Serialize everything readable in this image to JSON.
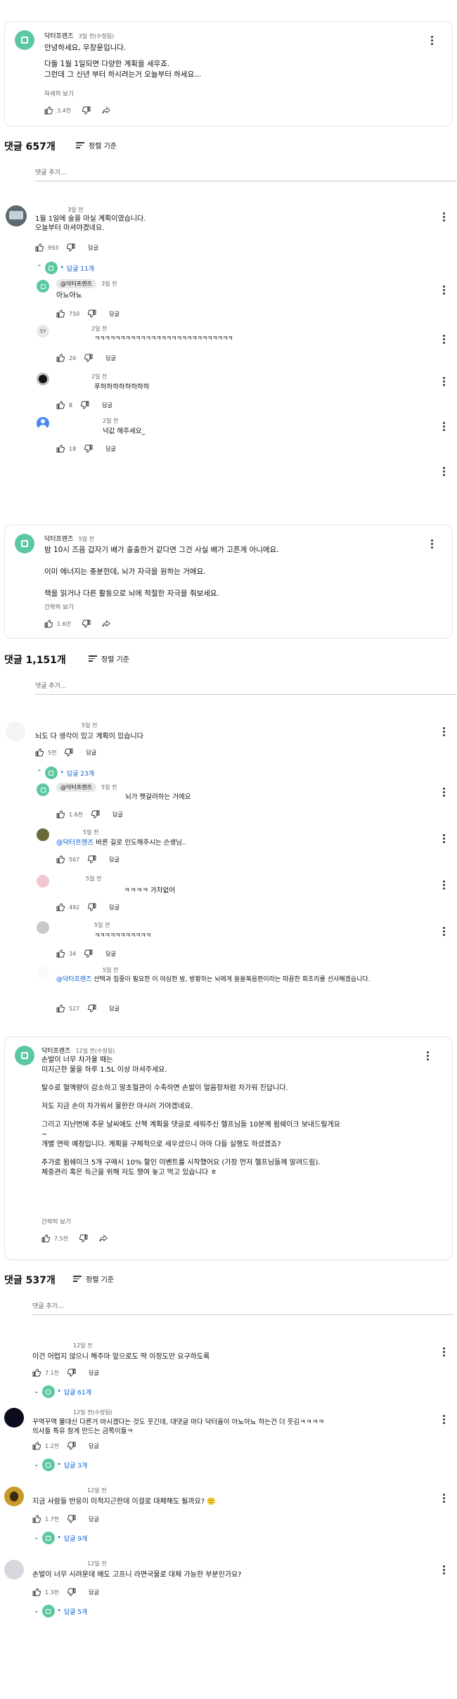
{
  "channel_name": "닥터프렌즈",
  "post1": {
    "author": "닥터프렌즈",
    "time": "3일 전(수정됨)",
    "body": [
      "안녕하세요, 우창윤입니다.",
      "",
      "다들 1월 1일되면 다양한 계획을 세우죠.",
      "그런데 그 신년 부터 하시려는거 오늘부터 하세요..."
    ],
    "more": "자세히 보기",
    "likes": "3.4천",
    "comments_header": "댓글 657개",
    "sort_label": "정렬 기준",
    "add_comment": "댓글 추가...",
    "comments": [
      {
        "time": "3일 전",
        "text": [
          "1월 1일에 술을 마실 계획이였습니다.",
          "오늘부터 마셔야겠네요."
        ],
        "likes": "993",
        "reply_label": "답글",
        "replies_count": "답글 11개",
        "replies": [
          {
            "author_badge": "@닥터프렌즈",
            "time": "3일 전",
            "text": "아뇨아뇨",
            "likes": "750",
            "reply_label": "답글"
          },
          {
            "time": "2일 전",
            "text": "ㅋㅋㅋㅋㅋㅋㅋㅋㅋㅋㅋㅋㅋㅋㅋㅋㅋㅋㅋㅋㅋㅋㅋㅋㅋㅋㅋ",
            "likes": "26",
            "reply_label": "답글",
            "avatar_text": "SY"
          },
          {
            "time": "2일 전",
            "text": "푸하하하하하하하하",
            "likes": "8",
            "reply_label": "답글"
          },
          {
            "time": "2일 전",
            "text": "넉값 해주세요_",
            "likes": "18",
            "reply_label": "답글"
          }
        ]
      }
    ]
  },
  "post2": {
    "author": "닥터프렌즈",
    "time": "5일 전",
    "body": [
      "밤 10시 즈음 갑자기 배가 출출한거 같다면 그건 사실 배가 고픈게 아니에요.",
      "",
      "이미 에너지는 충분한데, 뇌가 자극을 원하는 거에요.",
      "",
      "책을 읽거나 다른 활동으로 뇌에 적절한 자극을 줘보세요."
    ],
    "more": "간략히 보기",
    "likes": "1.6만",
    "comments_header": "댓글 1,151개",
    "sort_label": "정렬 기준",
    "add_comment": "댓글 추가...",
    "comments": [
      {
        "time": "5일 전",
        "text": [
          "뇌도 다 생각이 있고 계획이 있습니다"
        ],
        "likes": "5천",
        "reply_label": "답글",
        "replies_count": "답글 23개",
        "replies": [
          {
            "author_badge": "@닥터프렌즈",
            "time": "5일 전",
            "text": "뇌가 헷갈려하는 거에요",
            "likes": "1.6천",
            "reply_label": "답글"
          },
          {
            "time": "5일 전",
            "mention": "@닥터프렌즈",
            "text": "바른 길로 인도해주시는 슨생님..",
            "likes": "567",
            "reply_label": "답글"
          },
          {
            "time": "5일 전",
            "text": "ㅋㅋㅋㅋ 가차없어",
            "likes": "492",
            "reply_label": "답글"
          },
          {
            "time": "5일 전",
            "text": "ㅋㅋㅋㅋㅋㅋㅋㅋㅋㅋㅋ",
            "likes": "34",
            "reply_label": "답글"
          },
          {
            "time": "5일 전",
            "mention": "@닥터프렌즈",
            "text": "선택과 집중이 필요한 이 야심한 밤, 방황하는 뇌에게 쓸쓸복음편이라는 따끔한 회초리를 선사해겠습니다.",
            "likes": "527",
            "reply_label": "답글"
          }
        ]
      }
    ]
  },
  "post3": {
    "author": "닥터프렌즈",
    "time": "12일 전(수정됨)",
    "body": [
      "손발이 너무 차가울 때는",
      "미지근한 물을 하루 1.5L 이상 마셔주세요.",
      "",
      "탈수로 혈액량이 감소하고 말초혈관이 수축하면 손발이 얼음장처럼 차가워 진답니다.",
      "",
      "저도 지금 손이 차가워서 물한잔 마시러 가야겠네요.",
      "",
      "그리고 지난번에 추운 날씨에도 산책 계획을 댓글로 세워주신 헬프님들 10분께 윔쉐이크 보내드릴게요",
      "~",
      "개별 연락 예정입니다. 계획을 구체적으로 세우셨으니 아마 다들 실행도 하셨겠죠?",
      "",
      "추가로 윔쉐이크 5개 구매시 10% 할인 이벤트를 시작했어요 (가장 먼저 헬프님들께 알려드림).",
      "체중관리 혹은 득근을 위해 저도 쟁여 놓고 먹고 있습니다 ㅎ"
    ],
    "more": "간략히 보기",
    "likes": "7.5천",
    "comments_header": "댓글 537개",
    "sort_label": "정렬 기준",
    "add_comment": "댓글 추가...",
    "comments": [
      {
        "time": "12일 전",
        "text": [
          "이건 어렵지 않으니 해주마 앞으로도 딱 이정도만 요구하도록"
        ],
        "likes": "7.1천",
        "reply_label": "답글",
        "replies_count": "답글 61개"
      },
      {
        "time": "12일 전(수정됨)",
        "text": [
          "꾸역꾸역 물대신 다른거 마시겠다는 것도 웃긴데, 대댓글 마다 닥터윰이 아뇨아뇨 하는건 더 웃김ㅋㅋㅋㅋ",
          "의사들 특유 참게 만드는 금쪽이들ㅋ"
        ],
        "likes": "1.2천",
        "reply_label": "답글",
        "replies_count": "답글 3개"
      },
      {
        "time": "12일 전",
        "text": [
          "지금 사람들 반응이 미적지근한데 이걸로 대체해도 될까요? 🙂"
        ],
        "likes": "1.7천",
        "reply_label": "답글",
        "replies_count": "답글 9개"
      },
      {
        "time": "12일 전",
        "text": [
          "손발이 너무 시려운데 배도 고프니 라면국물로 대체 가능한 부분인가요?"
        ],
        "likes": "1.3천",
        "reply_label": "답글",
        "replies_count": "답글 5개"
      }
    ]
  }
}
